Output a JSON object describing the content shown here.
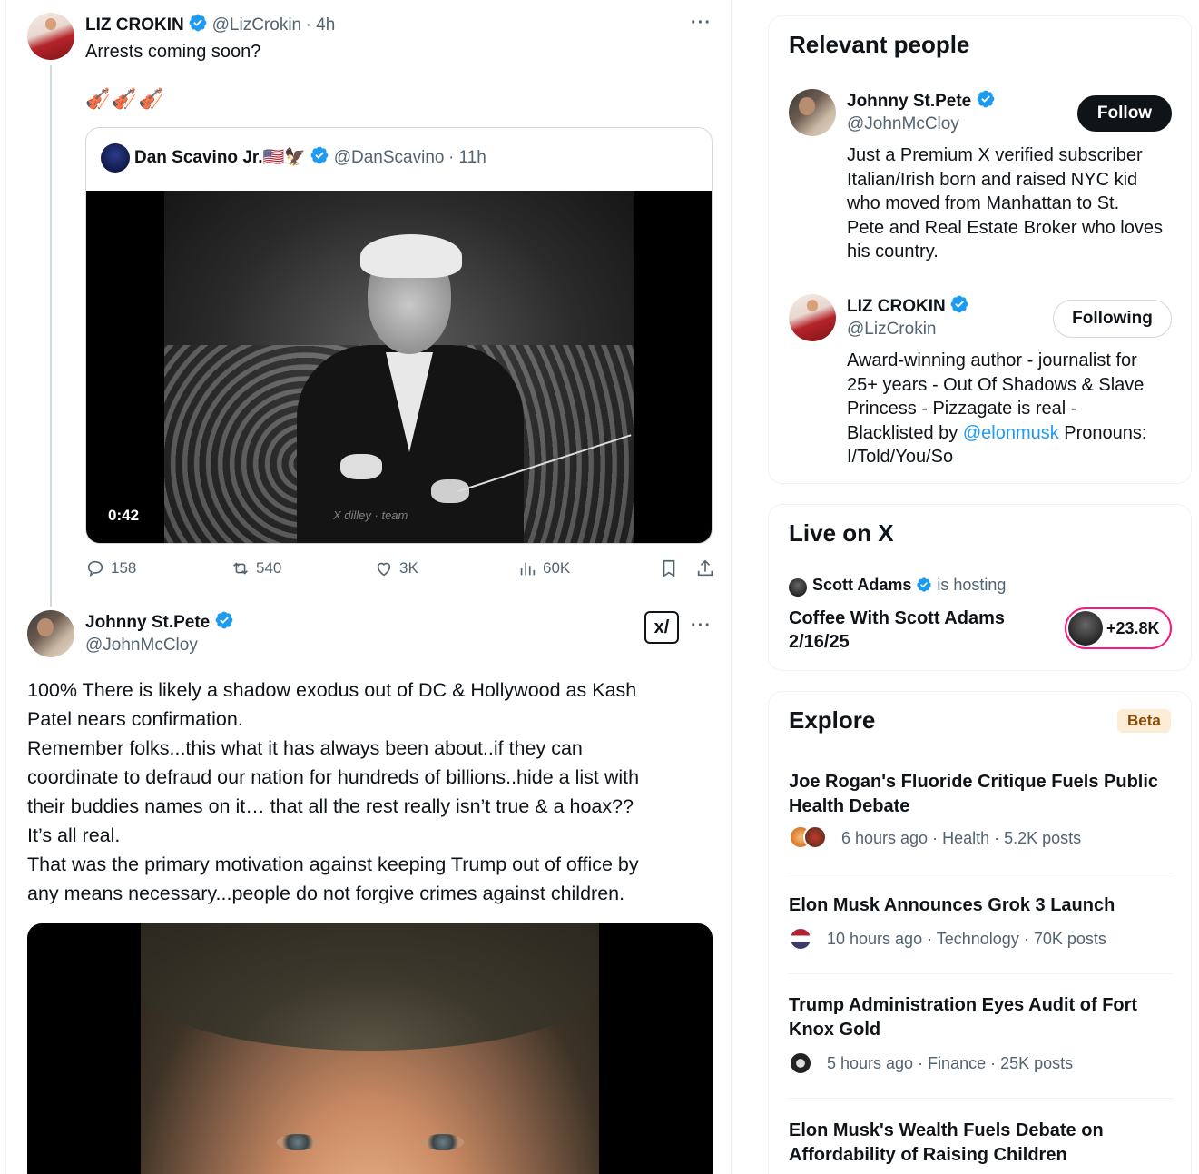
{
  "icons": {
    "verified": "verified-badge-icon",
    "more": "more-options-icon",
    "reply": "reply-icon",
    "retweet": "retweet-icon",
    "like": "like-icon",
    "views": "views-icon",
    "bookmark": "bookmark-icon",
    "share": "share-icon",
    "grok": "grok-icon"
  },
  "colors": {
    "accent": "#1d9bf0",
    "text": "#0f1419",
    "muted": "#536471",
    "live_ring": "#f91880"
  },
  "post1": {
    "name": "LIZ CROKIN",
    "handle": "@LizCrokin",
    "time": "· 4h",
    "text": "Arrests coming soon?",
    "emoji": "🎻🎻🎻",
    "more": "···",
    "quote": {
      "name": "Dan Scavino Jr.🇺🇸🦅",
      "handle": "@DanScavino",
      "time": "· 11h",
      "duration": "0:42",
      "watermark": "X dilley · team"
    },
    "stats": {
      "replies": "158",
      "reposts": "540",
      "likes": "3K",
      "views": "60K"
    }
  },
  "post2": {
    "name": "Johnny St.Pete",
    "handle": "@JohnMcCloy",
    "more": "···",
    "grok_label": "x/",
    "lines": [
      "100% There is likely a shadow exodus out of DC & Hollywood as Kash",
      "Patel nears confirmation.",
      "Remember folks...this what it has always been about..if they can",
      "coordinate to defraud our nation for hundreds of billions..hide a list with",
      "their buddies names on it… that all the rest really isn’t true & a hoax??",
      "It’s all real.",
      "That was the primary motivation against keeping Trump out of office by",
      "any means necessary...people do not forgive crimes against children."
    ]
  },
  "relevant": {
    "title": "Relevant people",
    "people": [
      {
        "name": "Johnny St.Pete",
        "handle": "@JohnMcCloy",
        "button": "Follow",
        "bio": [
          "Just a Premium X verified subscriber",
          "Italian/Irish born and raised NYC kid",
          "who moved from Manhattan to St.",
          "Pete and Real Estate Broker who loves",
          "his country."
        ]
      },
      {
        "name": "LIZ CROKIN",
        "handle": "@LizCrokin",
        "button": "Following",
        "bio": [
          "Award-winning author - journalist for",
          "25+ years - Out Of Shadows & Slave",
          "Princess - Pizzagate is real -"
        ],
        "bio_last_pre": "Blacklisted by ",
        "bio_link": "@elonmusk",
        "bio_last_post": " Pronouns:",
        "bio_end": "I/Told/You/So"
      }
    ]
  },
  "live": {
    "title": "Live on X",
    "host": "Scott Adams",
    "hosting": "is hosting",
    "show": [
      "Coffee With Scott Adams",
      "2/16/25"
    ],
    "listeners": "+23.8K"
  },
  "explore": {
    "title": "Explore",
    "badge": "Beta",
    "items": [
      {
        "title": [
          "Joe Rogan's Fluoride Critique Fuels Public",
          "Health Debate"
        ],
        "meta": "6 hours ago · Health · 5.2K posts"
      },
      {
        "title": [
          "Elon Musk Announces Grok 3 Launch"
        ],
        "meta": "10 hours ago · Technology · 70K posts"
      },
      {
        "title": [
          "Trump Administration Eyes Audit of Fort",
          "Knox Gold"
        ],
        "meta": "5 hours ago · Finance · 25K posts"
      },
      {
        "title": [
          "Elon Musk's Wealth Fuels Debate on",
          "Affordability of Raising Children"
        ],
        "meta": ""
      }
    ]
  }
}
